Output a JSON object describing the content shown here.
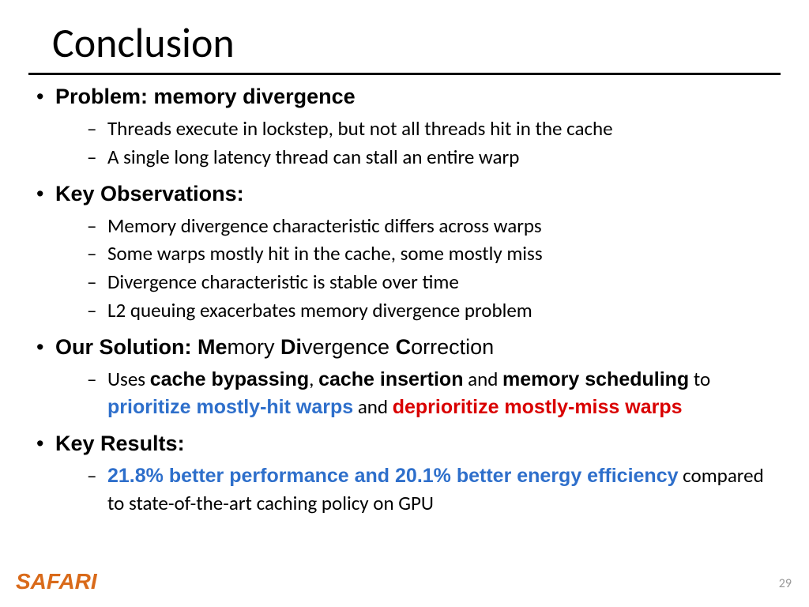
{
  "title": "Conclusion",
  "sections": [
    {
      "heading": "Problem: memory divergence",
      "items": [
        {
          "text": "Threads execute in lockstep, but not all threads hit in the cache"
        },
        {
          "text": "A single long latency thread can stall an entire warp"
        }
      ]
    },
    {
      "heading": "Key Observations:",
      "items": [
        {
          "text": "Memory divergence characteristic differs across warps"
        },
        {
          "text": "Some warps mostly hit in the cache, some mostly miss"
        },
        {
          "text": "Divergence characteristic is stable over time"
        },
        {
          "text": "L2 queuing exacerbates memory divergence problem"
        }
      ]
    },
    {
      "heading_parts": {
        "prefix": "Our Solution: ",
        "me_bold": "Me",
        "me_rest": "mory ",
        "di_bold": "Di",
        "di_rest": "vergence ",
        "c_bold": "C",
        "c_rest": "orrection"
      },
      "items": [
        {
          "runs": [
            {
              "t": "Uses "
            },
            {
              "t": "cache bypassing",
              "cls": "arialb"
            },
            {
              "t": ", "
            },
            {
              "t": "cache insertion",
              "cls": "arialb"
            },
            {
              "t": " and "
            },
            {
              "t": "memory scheduling",
              "cls": "arialb"
            },
            {
              "t": " to "
            },
            {
              "t": "prioritize mostly-hit warps",
              "cls": "blue"
            },
            {
              "t": " and "
            },
            {
              "t": "deprioritize mostly-miss warps",
              "cls": "red"
            }
          ]
        }
      ]
    },
    {
      "heading": "Key Results:",
      "items": [
        {
          "runs": [
            {
              "t": "21.8% better performance and 20.1% better energy efficiency",
              "cls": "blue"
            },
            {
              "t": " compared to state-of-the-art caching policy on GPU"
            }
          ]
        }
      ]
    }
  ],
  "logo": "SAFARI",
  "page": "29"
}
